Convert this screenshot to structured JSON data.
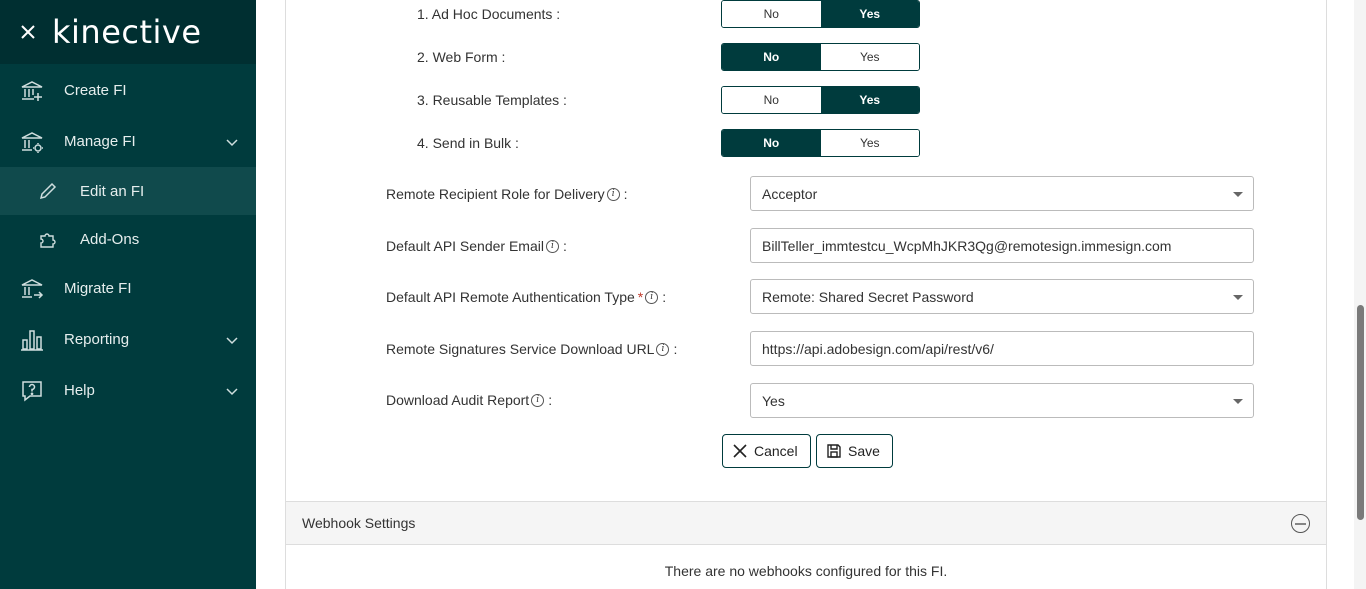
{
  "sidebar": {
    "logo": "kinective",
    "items": [
      {
        "label": "Create FI"
      },
      {
        "label": "Manage FI"
      },
      {
        "label": "Edit an FI"
      },
      {
        "label": "Add-Ons"
      },
      {
        "label": "Migrate FI"
      },
      {
        "label": "Reporting"
      },
      {
        "label": "Help"
      }
    ]
  },
  "form": {
    "toggles": [
      {
        "label": "1. Ad Hoc Documents :",
        "no": "No",
        "yes": "Yes",
        "selected": "Yes"
      },
      {
        "label": "2. Web Form :",
        "no": "No",
        "yes": "Yes",
        "selected": "No"
      },
      {
        "label": "3. Reusable Templates :",
        "no": "No",
        "yes": "Yes",
        "selected": "Yes"
      },
      {
        "label": "4. Send in Bulk :",
        "no": "No",
        "yes": "Yes",
        "selected": "No"
      }
    ],
    "recipient_role": {
      "label": "Remote Recipient Role for Delivery",
      "colon": ":",
      "value": "Acceptor"
    },
    "sender_email": {
      "label": "Default API Sender Email",
      "colon": ":",
      "value": "BillTeller_immtestcu_WcpMhJKR3Qg@remotesign.immesign.com"
    },
    "auth_type": {
      "label": "Default API Remote Authentication Type",
      "required": "*",
      "colon": ":",
      "value": "Remote: Shared Secret Password"
    },
    "download_url": {
      "label": "Remote Signatures Service Download URL",
      "colon": ":",
      "value": "https://api.adobesign.com/api/rest/v6/"
    },
    "audit_report": {
      "label": "Download Audit Report",
      "colon": ":",
      "value": "Yes"
    },
    "cancel_label": "Cancel",
    "save_label": "Save"
  },
  "webhooks": {
    "title": "Webhook Settings",
    "empty_message": "There are no webhooks configured for this FI."
  },
  "colors": {
    "sidebar_bg": "#003b3d",
    "accent": "#003b3d"
  }
}
